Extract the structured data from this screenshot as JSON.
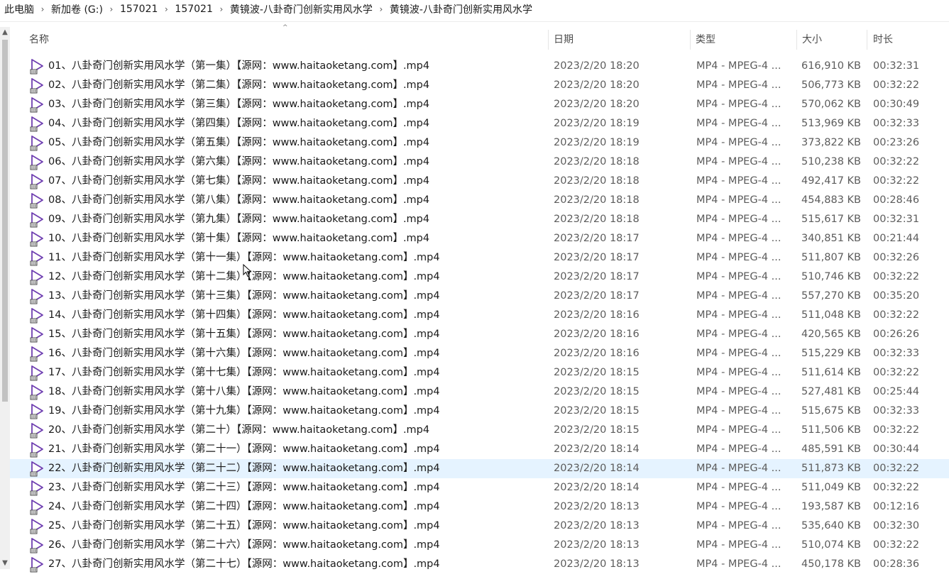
{
  "breadcrumb": [
    "此电脑",
    "新加卷 (G:)",
    "157021",
    "157021",
    "黄镜波-八卦奇门创新实用风水学",
    "黄镜波-八卦奇门创新实用风水学"
  ],
  "breadcrumb_separator": "›",
  "columns": {
    "name": "名称",
    "date": "日期",
    "type": "类型",
    "size": "大小",
    "duration": "时长"
  },
  "sort_indicator": "^",
  "scroll": {
    "up": "▲",
    "down": "▼"
  },
  "selected_index": 21,
  "files": [
    {
      "name": "01、八卦奇门创新实用风水学（第一集）【源网：www.haitaoketang.com】.mp4",
      "date": "2023/2/20 18:20",
      "type": "MP4 - MPEG-4 ...",
      "size": "616,910 KB",
      "duration": "00:32:31"
    },
    {
      "name": "02、八卦奇门创新实用风水学（第二集）【源网：www.haitaoketang.com】.mp4",
      "date": "2023/2/20 18:20",
      "type": "MP4 - MPEG-4 ...",
      "size": "506,773 KB",
      "duration": "00:32:22"
    },
    {
      "name": "03、八卦奇门创新实用风水学（第三集）【源网：www.haitaoketang.com】.mp4",
      "date": "2023/2/20 18:20",
      "type": "MP4 - MPEG-4 ...",
      "size": "570,062 KB",
      "duration": "00:30:49"
    },
    {
      "name": "04、八卦奇门创新实用风水学（第四集）【源网：www.haitaoketang.com】.mp4",
      "date": "2023/2/20 18:19",
      "type": "MP4 - MPEG-4 ...",
      "size": "513,969 KB",
      "duration": "00:32:33"
    },
    {
      "name": "05、八卦奇门创新实用风水学（第五集）【源网：www.haitaoketang.com】.mp4",
      "date": "2023/2/20 18:19",
      "type": "MP4 - MPEG-4 ...",
      "size": "373,822 KB",
      "duration": "00:23:26"
    },
    {
      "name": "06、八卦奇门创新实用风水学（第六集）【源网：www.haitaoketang.com】.mp4",
      "date": "2023/2/20 18:18",
      "type": "MP4 - MPEG-4 ...",
      "size": "510,238 KB",
      "duration": "00:32:22"
    },
    {
      "name": "07、八卦奇门创新实用风水学（第七集）【源网：www.haitaoketang.com】.mp4",
      "date": "2023/2/20 18:18",
      "type": "MP4 - MPEG-4 ...",
      "size": "492,417 KB",
      "duration": "00:32:22"
    },
    {
      "name": "08、八卦奇门创新实用风水学（第八集）【源网：www.haitaoketang.com】.mp4",
      "date": "2023/2/20 18:18",
      "type": "MP4 - MPEG-4 ...",
      "size": "454,883 KB",
      "duration": "00:28:46"
    },
    {
      "name": "09、八卦奇门创新实用风水学（第九集）【源网：www.haitaoketang.com】.mp4",
      "date": "2023/2/20 18:18",
      "type": "MP4 - MPEG-4 ...",
      "size": "515,617 KB",
      "duration": "00:32:31"
    },
    {
      "name": "10、八卦奇门创新实用风水学（第十集）【源网：www.haitaoketang.com】.mp4",
      "date": "2023/2/20 18:17",
      "type": "MP4 - MPEG-4 ...",
      "size": "340,851 KB",
      "duration": "00:21:44"
    },
    {
      "name": "11、八卦奇门创新实用风水学（第十一集）【源网：www.haitaoketang.com】.mp4",
      "date": "2023/2/20 18:17",
      "type": "MP4 - MPEG-4 ...",
      "size": "511,807 KB",
      "duration": "00:32:26"
    },
    {
      "name": "12、八卦奇门创新实用风水学（第十二集）【源网：www.haitaoketang.com】.mp4",
      "date": "2023/2/20 18:17",
      "type": "MP4 - MPEG-4 ...",
      "size": "510,746 KB",
      "duration": "00:32:22"
    },
    {
      "name": "13、八卦奇门创新实用风水学（第十三集）【源网：www.haitaoketang.com】.mp4",
      "date": "2023/2/20 18:17",
      "type": "MP4 - MPEG-4 ...",
      "size": "557,270 KB",
      "duration": "00:35:20"
    },
    {
      "name": "14、八卦奇门创新实用风水学（第十四集）【源网：www.haitaoketang.com】.mp4",
      "date": "2023/2/20 18:16",
      "type": "MP4 - MPEG-4 ...",
      "size": "511,048 KB",
      "duration": "00:32:22"
    },
    {
      "name": "15、八卦奇门创新实用风水学（第十五集）【源网：www.haitaoketang.com】.mp4",
      "date": "2023/2/20 18:16",
      "type": "MP4 - MPEG-4 ...",
      "size": "420,565 KB",
      "duration": "00:26:26"
    },
    {
      "name": "16、八卦奇门创新实用风水学（第十六集）【源网：www.haitaoketang.com】.mp4",
      "date": "2023/2/20 18:16",
      "type": "MP4 - MPEG-4 ...",
      "size": "515,229 KB",
      "duration": "00:32:33"
    },
    {
      "name": "17、八卦奇门创新实用风水学（第十七集）【源网：www.haitaoketang.com】.mp4",
      "date": "2023/2/20 18:15",
      "type": "MP4 - MPEG-4 ...",
      "size": "511,614 KB",
      "duration": "00:32:22"
    },
    {
      "name": "18、八卦奇门创新实用风水学（第十八集）【源网：www.haitaoketang.com】.mp4",
      "date": "2023/2/20 18:15",
      "type": "MP4 - MPEG-4 ...",
      "size": "527,481 KB",
      "duration": "00:25:44"
    },
    {
      "name": "19、八卦奇门创新实用风水学（第十九集）【源网：www.haitaoketang.com】.mp4",
      "date": "2023/2/20 18:15",
      "type": "MP4 - MPEG-4 ...",
      "size": "515,675 KB",
      "duration": "00:32:33"
    },
    {
      "name": "20、八卦奇门创新实用风水学（第二十）【源网：www.haitaoketang.com】.mp4",
      "date": "2023/2/20 18:15",
      "type": "MP4 - MPEG-4 ...",
      "size": "511,506 KB",
      "duration": "00:32:22"
    },
    {
      "name": "21、八卦奇门创新实用风水学（第二十一）【源网：www.haitaoketang.com】.mp4",
      "date": "2023/2/20 18:14",
      "type": "MP4 - MPEG-4 ...",
      "size": "485,591 KB",
      "duration": "00:30:44"
    },
    {
      "name": "22、八卦奇门创新实用风水学（第二十二）【源网：www.haitaoketang.com】.mp4",
      "date": "2023/2/20 18:14",
      "type": "MP4 - MPEG-4 ...",
      "size": "511,873 KB",
      "duration": "00:32:22"
    },
    {
      "name": "23、八卦奇门创新实用风水学（第二十三）【源网：www.haitaoketang.com】.mp4",
      "date": "2023/2/20 18:14",
      "type": "MP4 - MPEG-4 ...",
      "size": "511,049 KB",
      "duration": "00:32:22"
    },
    {
      "name": "24、八卦奇门创新实用风水学（第二十四）【源网：www.haitaoketang.com】.mp4",
      "date": "2023/2/20 18:13",
      "type": "MP4 - MPEG-4 ...",
      "size": "193,587 KB",
      "duration": "00:12:16"
    },
    {
      "name": "25、八卦奇门创新实用风水学（第二十五）【源网：www.haitaoketang.com】.mp4",
      "date": "2023/2/20 18:13",
      "type": "MP4 - MPEG-4 ...",
      "size": "535,640 KB",
      "duration": "00:32:30"
    },
    {
      "name": "26、八卦奇门创新实用风水学（第二十六）【源网：www.haitaoketang.com】.mp4",
      "date": "2023/2/20 18:13",
      "type": "MP4 - MPEG-4 ...",
      "size": "510,074 KB",
      "duration": "00:32:22"
    },
    {
      "name": "27、八卦奇门创新实用风水学（第二十七）【源网：www.haitaoketang.com】.mp4",
      "date": "2023/2/20 18:13",
      "type": "MP4 - MPEG-4 ...",
      "size": "450,178 KB",
      "duration": "00:28:36"
    }
  ],
  "colors": {
    "selected_row": "#e5f3ff",
    "icon_purple": "#6f3fb1",
    "secondary_text": "#5c5c5c"
  },
  "icons": {
    "file": "video-file-icon",
    "cursor": "mouse-cursor-icon"
  }
}
